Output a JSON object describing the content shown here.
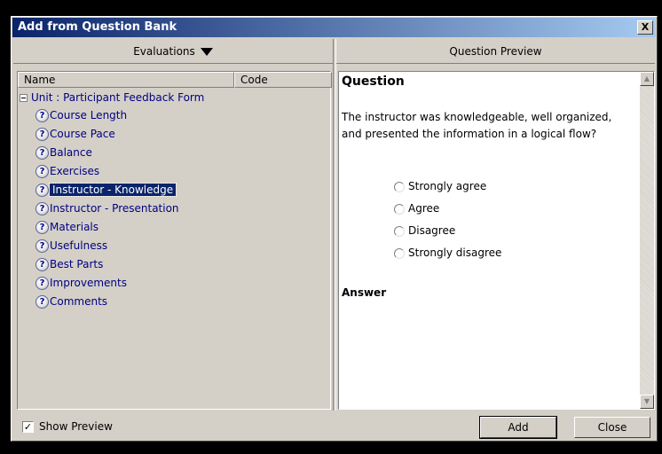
{
  "window": {
    "title": "Add from Question Bank",
    "close_glyph": "X"
  },
  "left_panel": {
    "dropdown_label": "Evaluations",
    "columns": [
      "Name",
      "Code"
    ],
    "unit_label": "Unit : Participant Feedback Form",
    "items": [
      {
        "label": "Course Length"
      },
      {
        "label": "Course Pace"
      },
      {
        "label": "Balance"
      },
      {
        "label": "Exercises"
      },
      {
        "label": "Instructor - Knowledge",
        "selected": true
      },
      {
        "label": "Instructor - Presentation"
      },
      {
        "label": "Materials"
      },
      {
        "label": "Usefulness"
      },
      {
        "label": "Best Parts"
      },
      {
        "label": "Improvements"
      },
      {
        "label": "Comments"
      }
    ],
    "item_icon_glyph": "?"
  },
  "right_panel": {
    "header": "Question Preview",
    "question_heading": "Question",
    "question_text": "The instructor was knowledgeable, well organized, and presented the information in a logical flow?",
    "options": [
      "Strongly agree",
      "Agree",
      "Disagree",
      "Strongly disagree"
    ],
    "answer_heading": "Answer"
  },
  "footer": {
    "show_preview_label": "Show Preview",
    "show_preview_checked": true,
    "add_label": "Add",
    "close_label": "Close"
  },
  "colors": {
    "title_start": "#0a246a",
    "title_end": "#a6caf0",
    "selection": "#0a246a",
    "tree_text": "#000080"
  },
  "icons": {
    "item": "question-bubble-icon",
    "dropdown": "triangle-down-icon"
  }
}
